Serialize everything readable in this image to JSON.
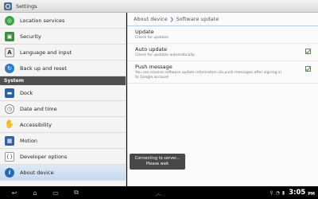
{
  "window": {
    "title": "Settings"
  },
  "sidebar": {
    "items": [
      {
        "label": "Location services",
        "icon": "location-icon"
      },
      {
        "label": "Security",
        "icon": "lock-icon"
      },
      {
        "label": "Language and input",
        "icon": "keyboard-icon",
        "glyph": "A"
      },
      {
        "label": "Back up and reset",
        "icon": "backup-icon"
      }
    ],
    "section_label": "System",
    "system_items": [
      {
        "label": "Dock",
        "icon": "dock-icon"
      },
      {
        "label": "Date and time",
        "icon": "clock-icon"
      },
      {
        "label": "Accessibility",
        "icon": "hand-icon"
      },
      {
        "label": "Motion",
        "icon": "motion-icon"
      },
      {
        "label": "Developer options",
        "icon": "developer-icon"
      },
      {
        "label": "About device",
        "icon": "info-icon",
        "glyph": "i",
        "active": true
      }
    ]
  },
  "main": {
    "breadcrumb": {
      "parent": "About device",
      "current": "Software update"
    },
    "settings": [
      {
        "title": "Update",
        "subtitle": "Check for updates",
        "checkbox": false
      },
      {
        "title": "Auto update",
        "subtitle": "Check for updates automatically",
        "checkbox": true,
        "checked": true
      },
      {
        "title": "Push message",
        "subtitle": "You can receive software update information via push messages after signing in to Google account",
        "checkbox": true,
        "checked": true
      }
    ]
  },
  "toast": {
    "line1": "Connecting to server...",
    "line2": "Please wait"
  },
  "statusbar": {
    "time": "3:05",
    "ampm": "PM"
  },
  "colors": {
    "accent": "#2569b8",
    "check": "#2ea02e",
    "section_bg": "#4f4f4f"
  }
}
